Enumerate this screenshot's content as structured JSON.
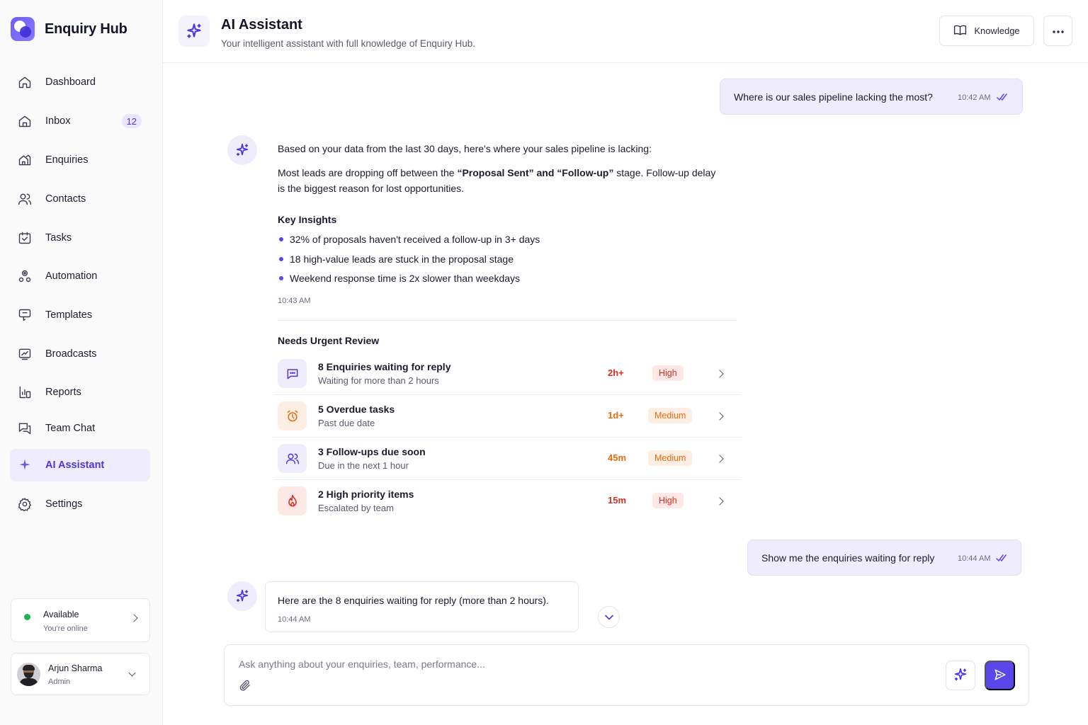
{
  "app": {
    "name": "Enquiry Hub"
  },
  "sidebar": {
    "items": [
      {
        "label": "Dashboard",
        "icon": "home-icon"
      },
      {
        "label": "Inbox",
        "icon": "inbox-icon",
        "badge": "12"
      },
      {
        "label": "Enquiries",
        "icon": "enquiries-icon"
      },
      {
        "label": "Contacts",
        "icon": "contacts-icon"
      },
      {
        "label": "Tasks",
        "icon": "tasks-icon"
      },
      {
        "label": "Automation",
        "icon": "automation-icon"
      },
      {
        "label": "Templates",
        "icon": "templates-icon"
      },
      {
        "label": "Broadcasts",
        "icon": "broadcasts-icon"
      },
      {
        "label": "Reports",
        "icon": "reports-icon"
      },
      {
        "label": "Team Chat",
        "icon": "team-chat-icon"
      },
      {
        "label": "AI Assistant",
        "icon": "sparkle-icon",
        "active": true
      },
      {
        "label": "Settings",
        "icon": "settings-icon"
      }
    ],
    "status": {
      "title": "Available",
      "subtitle": "You're online",
      "color": "#1fb254"
    },
    "user": {
      "name": "Arjun Sharma",
      "role": "Admin"
    }
  },
  "header": {
    "title": "AI Assistant",
    "subtitle": "Your intelligent assistant with full knowledge of Enquiry Hub.",
    "knowledge_label": "Knowledge"
  },
  "chat": {
    "user_msg_1": {
      "text": "Where is our sales pipeline lacking the most?",
      "time": "10:42 AM"
    },
    "ai_msg_1": {
      "intro": "Based on your data from the last 30 days, here's where your sales pipeline is lacking:",
      "p2_a": "Most leads are dropping off between the ",
      "p2_b": "“Proposal Sent” and “Follow-up”",
      "p2_c": " stage. Follow-up delay",
      "p2_d": "is the biggest reason for lost opportunities.",
      "insights_title": "Key Insights",
      "insights": [
        "32% of proposals haven't received a follow-up in 3+ days",
        "18 high-value leads are stuck in the proposal stage",
        "Weekend response time is 2x slower than weekdays"
      ],
      "time": "10:43 AM",
      "review_title": "Needs Urgent Review",
      "review_items": [
        {
          "title": "8 Enquiries waiting for reply",
          "subtitle": "Waiting for more than 2 hours",
          "time": "2h+",
          "priority": "High",
          "icon": "message-icon"
        },
        {
          "title": "5 Overdue tasks",
          "subtitle": "Past due date",
          "time": "1d+",
          "priority": "Medium",
          "icon": "alarm-clock-icon"
        },
        {
          "title": "3 Follow-ups due soon",
          "subtitle": "Due in the next 1 hour",
          "time": "45m",
          "priority": "Medium",
          "icon": "users-icon"
        },
        {
          "title": "2 High priority items",
          "subtitle": "Escalated by team",
          "time": "15m",
          "priority": "High",
          "icon": "flame-icon"
        }
      ]
    },
    "user_msg_2": {
      "text": "Show me the enquiries waiting for reply",
      "time": "10:44 AM"
    },
    "ai_msg_2": {
      "text": "Here are the 8 enquiries waiting for reply (more than 2 hours).",
      "time": "10:44 AM"
    }
  },
  "composer": {
    "placeholder": "Ask anything about your enquiries, team, performance..."
  },
  "colors": {
    "accent": "#5a46ea",
    "high": "#d92d20",
    "medium": "#ec6a0b"
  }
}
